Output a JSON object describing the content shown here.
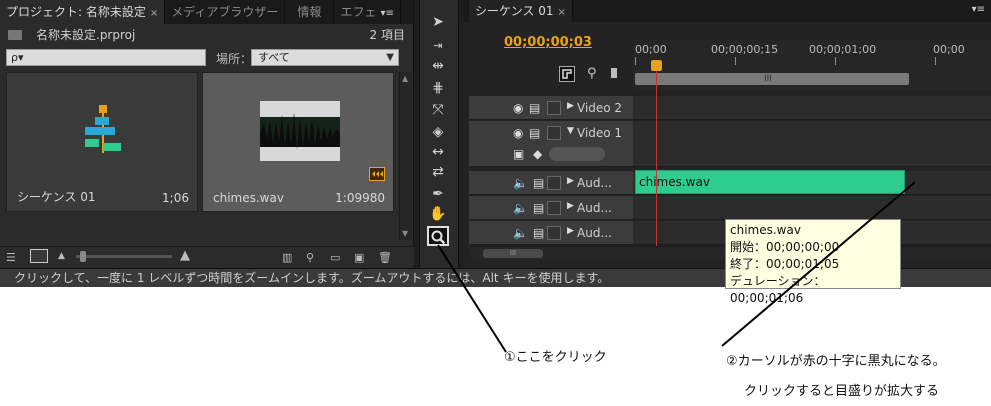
{
  "project_panel": {
    "tabs": [
      {
        "label": "プロジェクト: 名称未設定",
        "close": "×"
      },
      {
        "label": "メディアブラウザー"
      },
      {
        "label": "情報"
      },
      {
        "label": "エフェ"
      }
    ],
    "tab_menu_icon": "▾≡",
    "project_file": "名称未設定.prproj",
    "item_count": "2 項目",
    "search_placeholder": "ρ▾",
    "location_label": "場所：",
    "location_value": "すべて",
    "items": [
      {
        "name": "シーケンス 01",
        "duration": "1;06",
        "icon": "sequence-icon"
      },
      {
        "name": "chimes.wav",
        "duration": "1:09980",
        "icon": "audio-waveform-thumbnail"
      }
    ]
  },
  "tools": [
    "selection-tool",
    "track-select-tool",
    "ripple-edit-tool",
    "rolling-edit-tool",
    "rate-stretch-tool",
    "razor-tool",
    "slip-tool",
    "slide-tool",
    "pen-tool",
    "hand-tool",
    "zoom-tool"
  ],
  "sequence_panel": {
    "tab_label": "シーケンス 01",
    "tab_close": "×",
    "timecode": "00;00;00;03",
    "ruler_labels": [
      "00;00",
      "00;00;00;15",
      "00;00;01;00",
      "00;00"
    ],
    "workarea_mark": "III",
    "tracks": [
      {
        "name": "Video 2",
        "kind": "video"
      },
      {
        "name": "Video 1",
        "kind": "video"
      },
      {
        "name": "Aud...",
        "kind": "audio"
      },
      {
        "name": "Aud...",
        "kind": "audio"
      },
      {
        "name": "Aud...",
        "kind": "audio"
      }
    ],
    "clip_label": "chimes.wav",
    "scroll_mark": "III"
  },
  "tooltip": {
    "title": "chimes.wav",
    "start": "開始：00;00;00;00",
    "end": "終了：00;00;01;05",
    "duration": "デュレーション：00;00;01;06"
  },
  "status_text": "クリックして、一度に 1 レベルずつ時間をズームインします。ズームアウトするには、Alt キーを使用します。",
  "annotations": {
    "step1": "①ここをクリック",
    "step2_line1": "②カーソルが赤の十字に黒丸になる。",
    "step2_line2": "クリックすると目盛りが拡大する"
  }
}
